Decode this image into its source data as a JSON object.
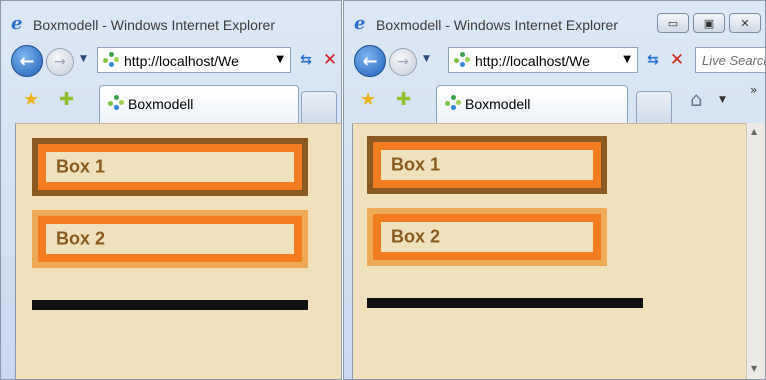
{
  "windows": [
    {
      "title": "Boxmodell - Windows Internet Explorer",
      "url": "http://localhost/We",
      "tab_label": "Boxmodell",
      "boxes": [
        "Box 1",
        "Box 2"
      ]
    },
    {
      "title": "Boxmodell - Windows Internet Explorer",
      "url": "http://localhost/We",
      "tab_label": "Boxmodell",
      "search_placeholder": "Live Search",
      "boxes": [
        "Box 1",
        "Box 2"
      ]
    }
  ],
  "icons": {
    "ie": "ie-logo-icon",
    "back": "back-arrow-icon",
    "forward": "forward-arrow-icon",
    "refresh": "refresh-icon",
    "stop": "stop-icon",
    "favorites": "star-icon",
    "add_favorites": "add-favorite-icon",
    "home": "home-icon",
    "page": "page-icon"
  },
  "colors": {
    "page_background": "#f0e0bc",
    "box_fill": "#f47c20",
    "box1_border": "#8b5a22",
    "box2_border": "#eeaa55",
    "box_text": "#8b5a22",
    "rule": "#111111"
  }
}
